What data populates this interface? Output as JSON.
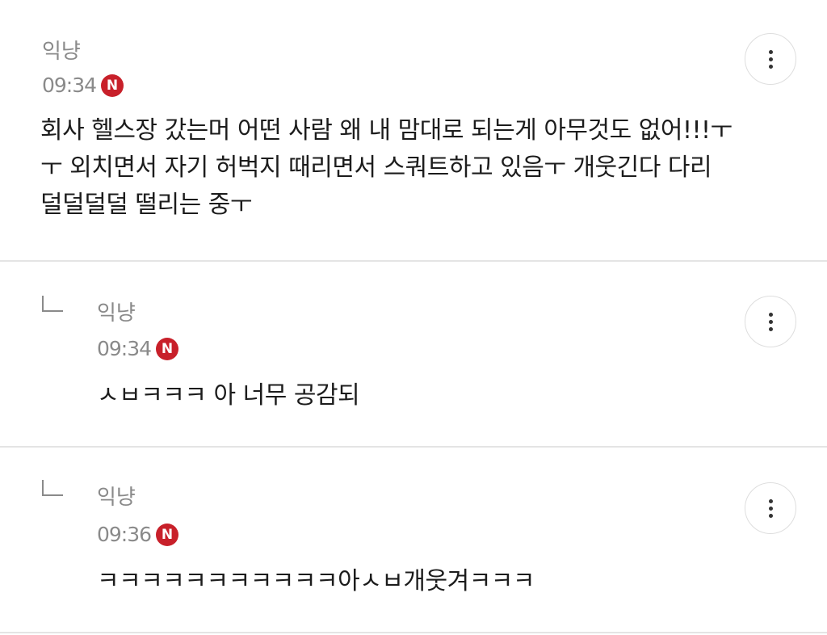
{
  "comments": [
    {
      "author": "익냥",
      "time": "09:34",
      "badge": "N",
      "body_lines": [
        "회사 헬스장 갔는머 어떤 사람 왜 내 맘대로 되는게 아무것도 없어!!!ㅜ",
        "ㅜ 외치면서 자기 허벅지 때리면서 스쿼트하고 있음ㅜ 개웃긴다 다리",
        "덜덜덜덜 떨리는 중ㅜ"
      ],
      "is_reply": false
    },
    {
      "author": "익냥",
      "time": "09:34",
      "badge": "N",
      "body_lines": [
        "ㅅㅂㅋㅋㅋ 아 너무 공감되"
      ],
      "is_reply": true
    },
    {
      "author": "익냥",
      "time": "09:36",
      "badge": "N",
      "body_lines": [
        "ㅋㅋㅋㅋㅋㅋㅋㅋㅋㅋㅋ아ㅅㅂ개웃겨ㅋㅋㅋ"
      ],
      "is_reply": true
    }
  ],
  "icons": {
    "more": "more-vertical-icon",
    "reply": "reply-arrow-icon",
    "new": "new-badge-icon"
  },
  "colors": {
    "badge": "#c8202a",
    "meta_text": "#8a8a8a",
    "body_text": "#1c1c1c",
    "divider": "#e4e4e4"
  }
}
